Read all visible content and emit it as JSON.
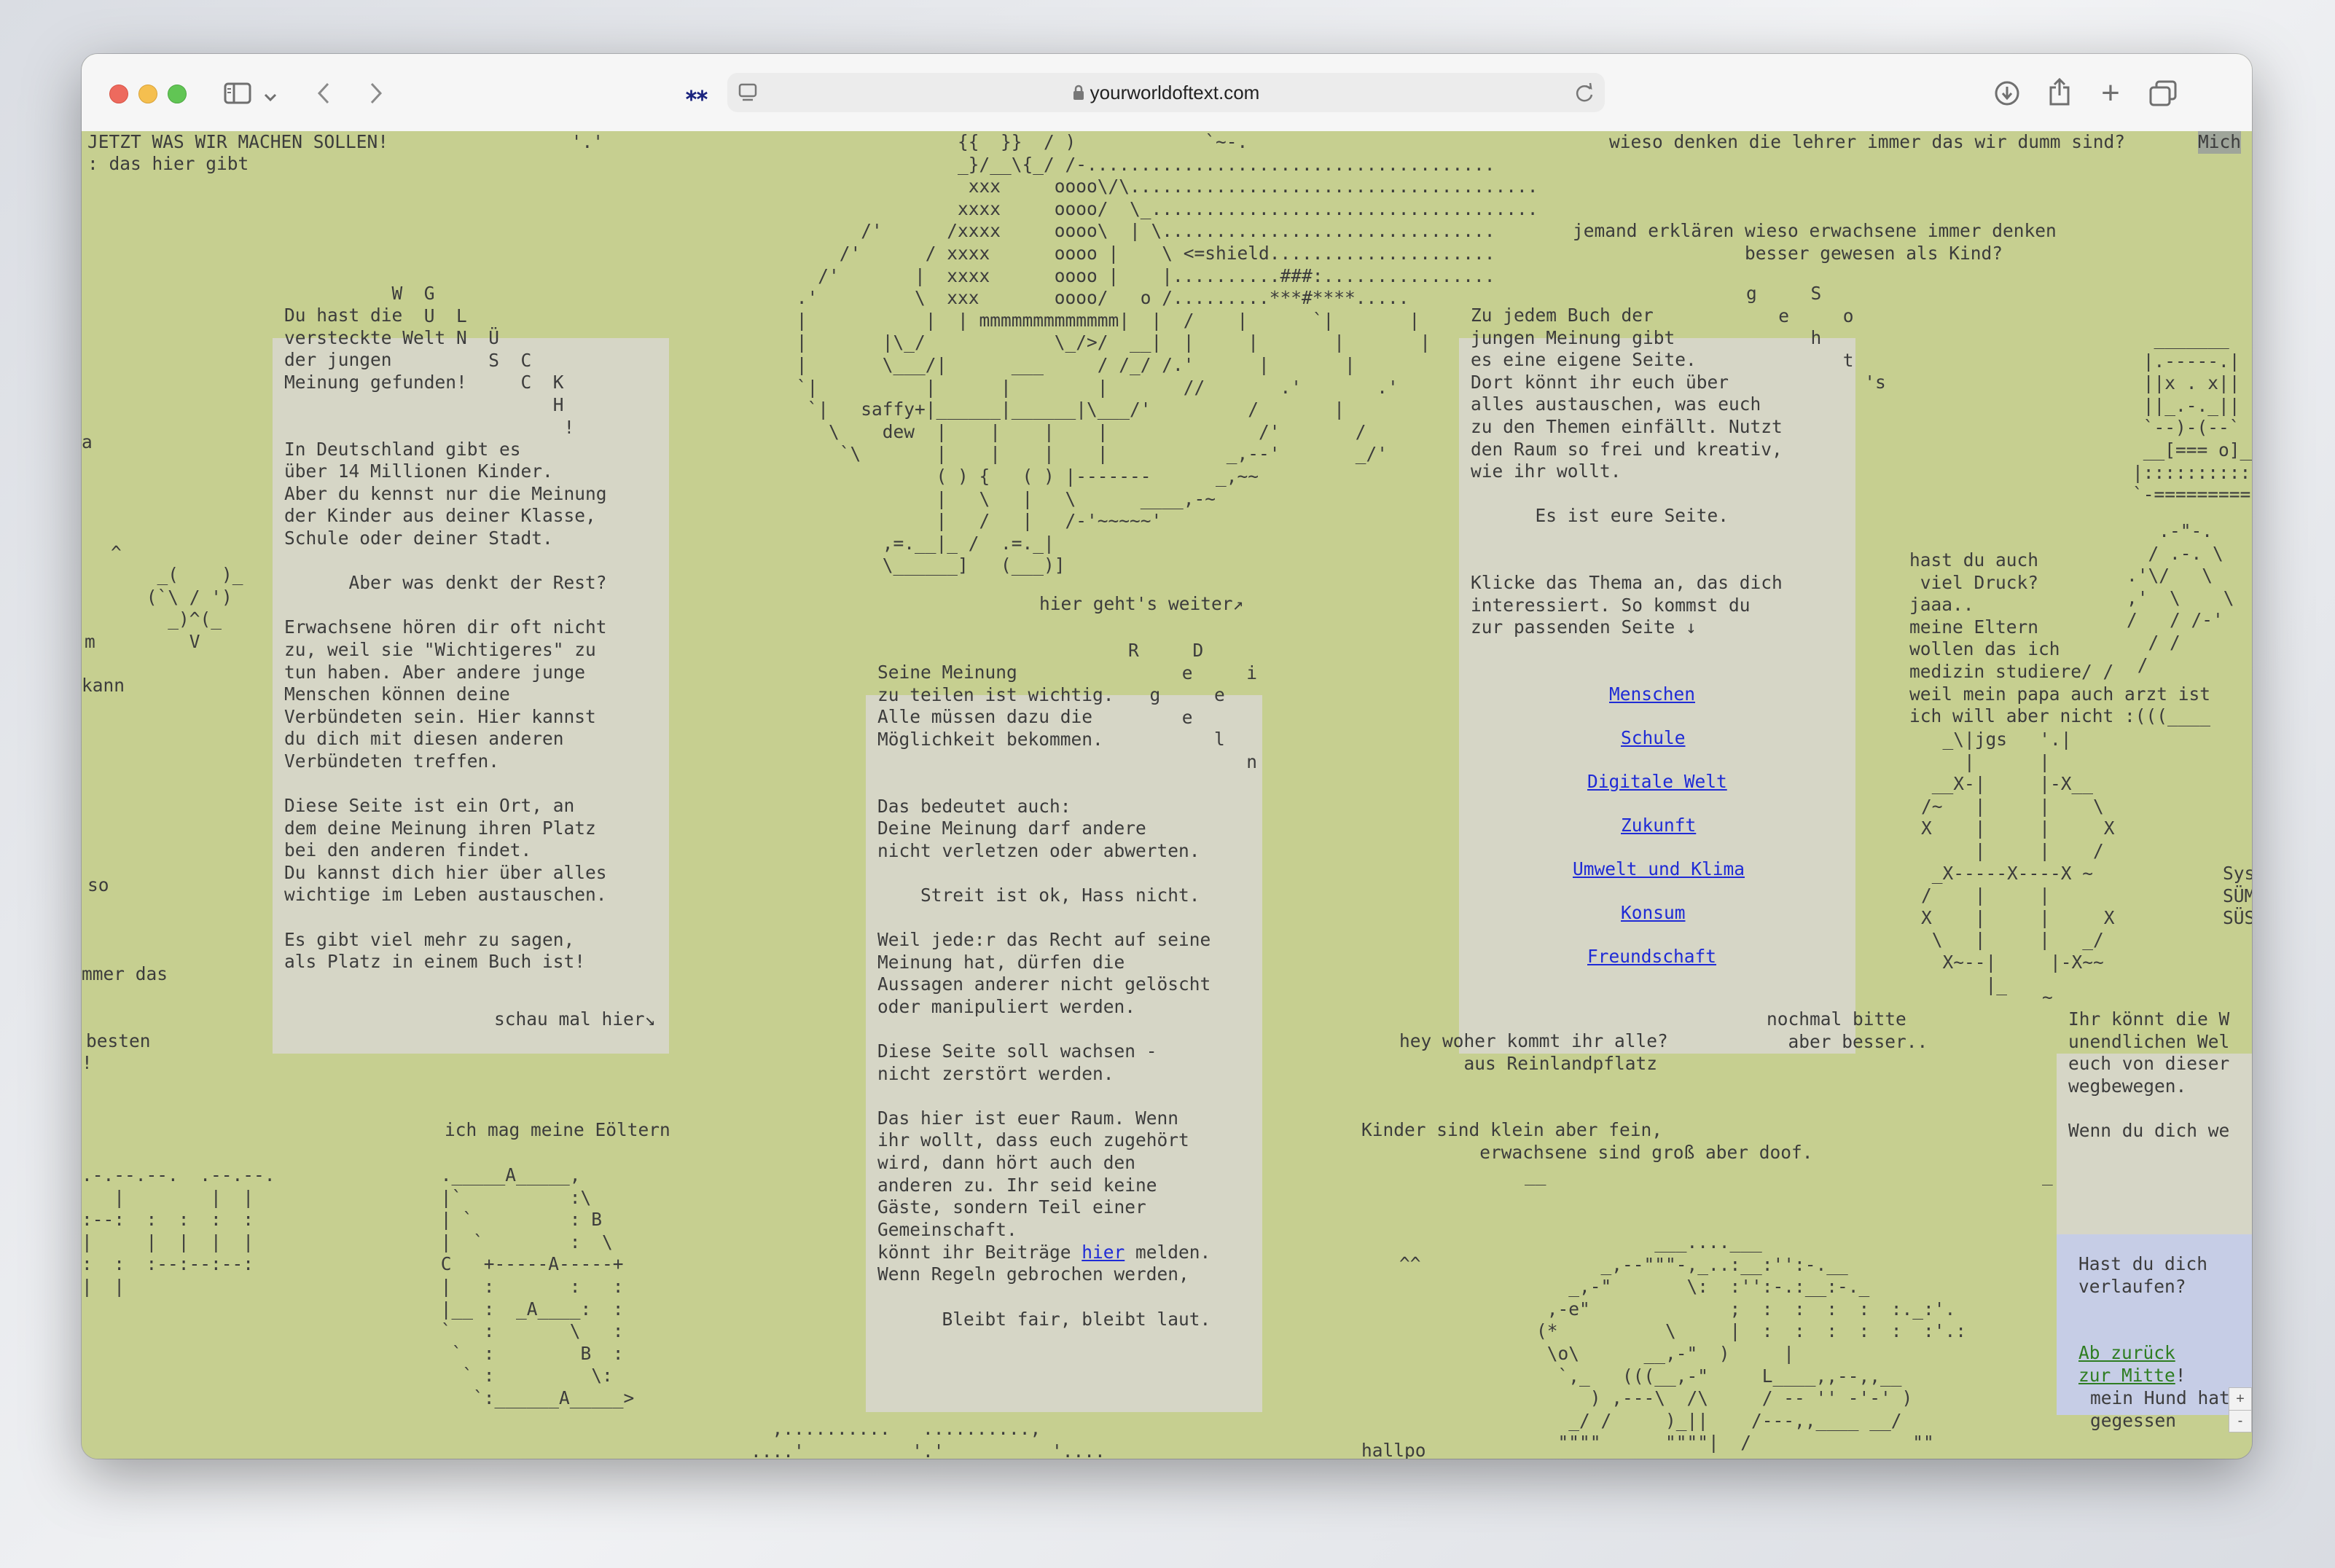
{
  "browser": {
    "url": "yourworldoftext.com",
    "icons": {
      "sidebar": "sidebar-icon",
      "chevron": "chevron-down-icon",
      "back": "back-icon",
      "forward": "forward-icon",
      "extension": "asterisk-extension-icon",
      "reader": "page-menu-icon",
      "lock": "lock-icon",
      "reload": "reload-icon",
      "download": "download-icon",
      "share": "share-icon",
      "newtab": "plus-icon",
      "tabs": "tabs-overview-icon"
    },
    "glyphs": {
      "extension": "⁎⁎",
      "back": "‹",
      "forward": "›",
      "newtab": "+",
      "lock": "🔒"
    }
  },
  "world": {
    "texts": {
      "t_top_left": "JETZT WAS WIR MACHEN SOLLEN!                 '.'",
      "t_top_left2": ": das hier gibt",
      "t_top_right": "wieso denken die lehrer immer das wir dumm sind?",
      "t_top_right_sel": "Mich",
      "t_jemand": "jemand erklären wieso erwachsene immer denken\n                besser gewesen als Kind?",
      "t_left_frag1": "a",
      "t_left_caret": "^",
      "t_left_frag2": "m",
      "t_left_frag3": "kann",
      "t_left_frag4": "so",
      "t_left_frag5": "mmer das",
      "t_left_frag6": "besten",
      "t_left_frag7": "!",
      "t_schau": "schau mal hier↘",
      "t_eoeltern": "ich mag meine Eöltern",
      "t_weiter": "hier geht's weiter↗",
      "t_hey": "hey woher kommt ihr alle?\n      aus Reinlandpflatz",
      "t_nochmal": "nochmal bitte\n  aber besser..",
      "t_kinder": "Kinder sind klein aber fein,\n           erwachsene sind groß aber doof.",
      "t_underscore": "__",
      "t_carets": "^^",
      "t_hallpo": "hallpo",
      "t_hund": "mein Hund hat\ngegessen",
      "t_hast_druck": "hast du auch\n viel Druck?\njaaa..\nmeine Eltern\nwollen das ich\nmedizin studiere/ /\nweil mein papa auch arzt ist\nich will aber nicht :(((____",
      "t_sys": "Sys\nSÜM\nSÜS",
      "t_right_tilde": "~",
      "t_right_line": "_",
      "t_dots_bottom": "  ,..........   ..........,\n....'          '.'          '....",
      "t_wg_letters": "          W  G\n             U  L\n                N  Ü\n                   S  C\n                      C  K\n                         H\n                          !",
      "t_rd_letters": "R     D\n     e     i\n  g     e\n     e\n        l\n           n",
      "t_gs_letters": "g     S\n   e     o\n      h\n         t\n           's"
    },
    "art": {
      "shield": "                {{  }}  / )            `~-.\n                _}/__\\{_/ /-......................................\n                 xxx     oooo\\/\\......................................\n                xxxx     oooo/  \\_....................................\n       /'      /xxxx     oooo\\  | \\...............................\n     /'      / xxxx      oooo |    \\ <=shield.....................\n   /'       |  xxxx      oooo |    |..........###:................\n .'         \\  xxx       oooo/   o /.........***#****.....\n |           |  | mmmmmmmmmmmmm|  |  /    |      `|       |\n |       |\\_/            \\_/>/  __|  |     |       |       |\n |       \\___/|      ___     / /_/ /.'      |       |\n `|          |      |        |       //       .'       .'\n  `|   saffy+|______|______|\\___/'         /       |\n    \\    dew  |    |    |    |              /'       /\n     `\\       |    |    |    |           _,--'       _/'\n              ( ) {   ( ) |-------      _,~~\n              |   \\   |   \\      ____,-~\n              |   /   |   /-'~~~~~'\n         ,=.__|_ /  .=._|\n         \\______]   (___)]",
      "owl": "  _(    )_\n (`\\ / ')\n   _)^(_\n     V",
      "robot": "  _______\n |.-----.|\n ||x . x||\n ||_.-._||\n `--)-(--`\n __[=== o]__\n|:::::::::::|\n`-=========-`",
      "flower": "   .-\"-.\n  / .-. \\\n.'\\/   \\\n,'  \\    \\\n/   / /-'\n  / /\n /",
      "jgs": "  _\\|jgs   '.|\n    |      |\n __X-|     |-X__\n/~   |     |    \\\nX    |     |     X\n     |     |    /\n _X-----X----X ~\n/    |     |\nX    |     |     X\n \\   |     |   _/\n  X~--|     |-X~~\n      |_",
      "grid_left": ".-.--.--.  .--.--.\n   |        |  |\n:--:  :  :  :  :\n|     |  |  |  |\n:  :  :--:--:--:\n|  |",
      "building": " ._____A_____,\n |`          :\\\n | `         : B\n |  `        :  \\\n C   +-----A-----+\n |   :       :   :\n |__ :  _A____:  :\n `   :       \\   :\n  `  :        B  :\n   ` :         \\:\n    `:______A_____>",
      "tortoise": "           ___....___\n      _,--\"\"\"-,_..:__:'':-.__\n   _,-\"       \\:  :'':-.:__:-._\n ,-e\"             ;  :  :  :  :  :._:'.\n(*          \\     |  :  :  :  :  :  :'.:\n \\o\\      __,-\"  )     |\n  `,_   (((__,-\"     L____,,--,,__\n     ) ,---\\  /\\     / -- '' -'-' )\n   _/ /     )_||    /---,,____ __/\n  \"\"\"\"      \"\"\"\"|  /               \"\""
    },
    "boxes": {
      "b1": "Du hast die\nversteckte Welt\nder jungen\nMeinung gefunden!\n\n\nIn Deutschland gibt es\nüber 14 Millionen Kinder.\nAber du kennst nur die Meinung\nder Kinder aus deiner Klasse,\nSchule oder deiner Stadt.\n\n      Aber was denkt der Rest?\n\nErwachsene hören dir oft nicht\nzu, weil sie \"Wichtigeres\" zu\ntun haben. Aber andere junge\nMenschen können deine\nVerbündeten sein. Hier kannst\ndu dich mit diesen anderen\nVerbündeten treffen.\n\nDiese Seite ist ein Ort, an\ndem deine Meinung ihren Platz\nbei den anderen findet.\nDu kannst dich hier über alles\nwichtige im Leben austauschen.\n\nEs gibt viel mehr zu sagen,\nals Platz in einem Buch ist!",
      "b2_main": "Seine Meinung\nzu teilen ist wichtig.\nAlle müssen dazu die\nMöglichkeit bekommen.\n\n\nDas bedeutet auch:\nDeine Meinung darf andere\nnicht verletzen oder abwerten.\n\n    Streit ist ok, Hass nicht.\n\nWeil jede:r das Recht auf seine\nMeinung hat, dürfen die\nAussagen anderer nicht gelöscht\noder manipuliert werden.\n\nDiese Seite soll wachsen -\nnicht zerstört werden.\n\nDas hier ist euer Raum. Wenn\nihr wollt, dass euch zugehört\nwird, dann hört auch den\nanderen zu. Ihr seid keine\nGäste, sondern Teil einer\nGemeinschaft.\n\nWenn Regeln gebrochen werden,",
      "b2_report_pre": "könnt ihr Beiträge ",
      "b2_report_link": "hier",
      "b2_report_post": " melden.",
      "b2_end": "      Bleibt fair, bleibt laut.",
      "b3": "Zu jedem Buch der\njungen Meinung gibt\nes eine eigene Seite.\nDort könnt ihr euch über\nalles austauschen, was euch\nzu den Themen einfällt. Nutzt\nden Raum so frei und kreativ,\nwie ihr wollt.\n\n      Es ist eure Seite.\n\n\nKlicke das Thema an, das dich\ninteressiert. So kommst du\nzur passenden Seite ↓",
      "b4": "Ihr könnt die W\nunendlichen Wel\neuch von dieser\nwegbewegen.\n\nWenn du dich we",
      "b5": "Hast du dich\nverlaufen?",
      "b5_link": "Ab zurück\nzur Mitte",
      "b5_bang": "!"
    },
    "topics": [
      "Menschen",
      "Schule",
      "Digitale Welt",
      "Zukunft",
      "Umwelt und Klima",
      "Konsum",
      "Freundschaft"
    ],
    "zoom": {
      "plus": "+",
      "minus": "-"
    }
  },
  "colors": {
    "world_bg": "#c6cf90",
    "box_bg": "#d6d6c6",
    "link": "#1f2bd6",
    "help_box": "#c6cde6",
    "help_link": "#2e7d22"
  }
}
